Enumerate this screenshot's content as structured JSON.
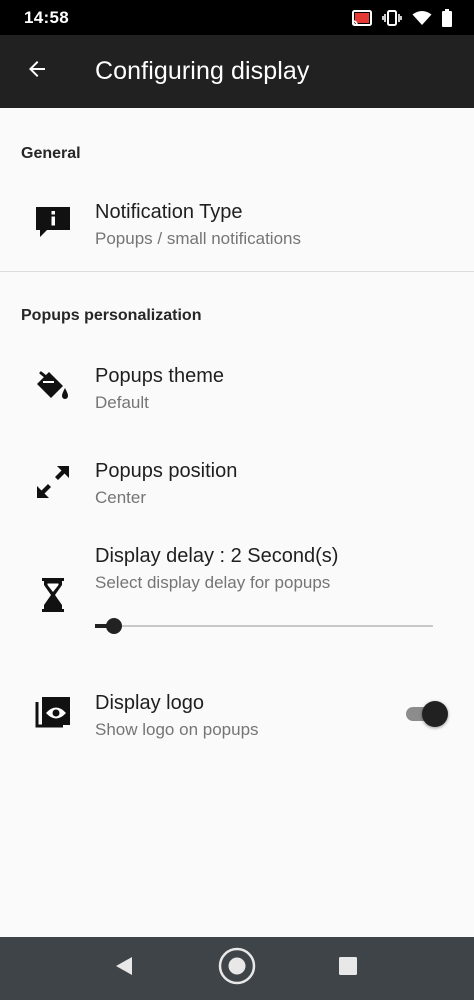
{
  "status_bar": {
    "time": "14:58"
  },
  "app_bar": {
    "title": "Configuring display"
  },
  "general": {
    "header": "General",
    "notification_type": {
      "title": "Notification Type",
      "summary": "Popups / small notifications"
    }
  },
  "popups": {
    "header": "Popups personalization",
    "theme": {
      "title": "Popups theme",
      "summary": "Default"
    },
    "position": {
      "title": "Popups position",
      "summary": "Center"
    },
    "display_delay": {
      "title": "Display delay : 2 Second(s)",
      "summary": "Select display delay for popups",
      "level": 0.04
    },
    "display_logo": {
      "title": "Display logo",
      "summary": "Show logo on popups",
      "enabled": true
    }
  },
  "colors": {
    "app_bar": "#212121",
    "accent": "#212121",
    "nav_bar": "#3e4448"
  },
  "icons": {
    "back": "arrow-left-icon",
    "notification_type": "info-message-icon",
    "theme": "paint-bucket-icon",
    "position": "expand-arrows-icon",
    "delay": "hourglass-icon",
    "logo": "logo-eye-icon"
  }
}
